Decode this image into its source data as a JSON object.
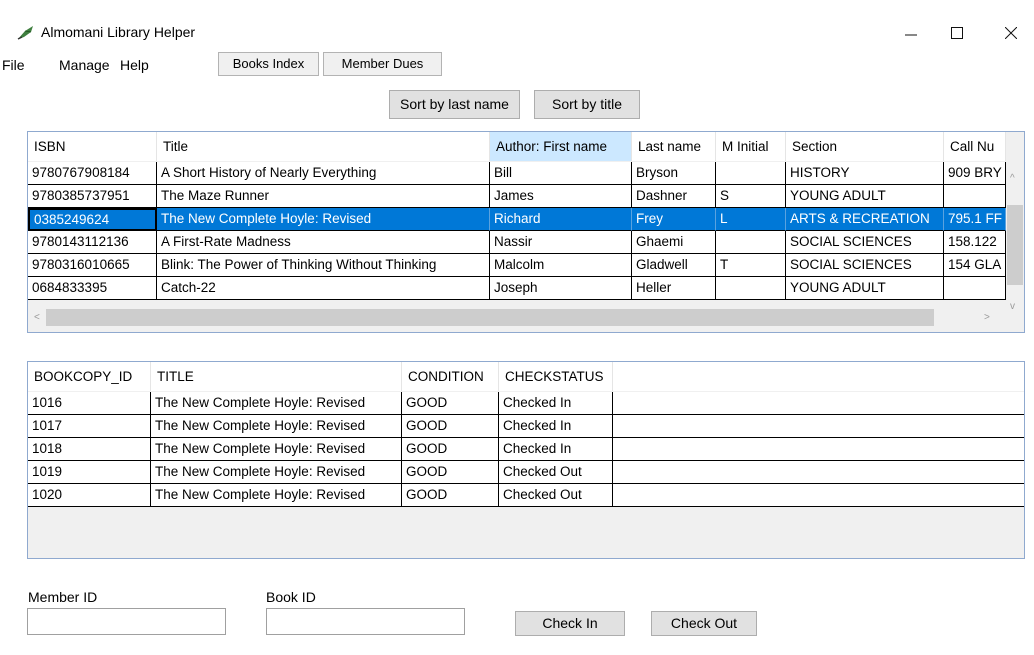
{
  "window": {
    "title": "Almomani Library Helper",
    "controls": {
      "minimize": "—",
      "maximize": "☐",
      "close": "✕"
    }
  },
  "menu": [
    "File",
    "Manage",
    "Help"
  ],
  "tabs": [
    {
      "label": "Books Index",
      "active": true
    },
    {
      "label": "Member Dues",
      "active": false
    }
  ],
  "sort_buttons": {
    "by_last_name": "Sort by last name",
    "by_title": "Sort by title"
  },
  "books_grid": {
    "columns": [
      "ISBN",
      "Title",
      "Author: First name",
      "Last name",
      "M Initial",
      "Section",
      "Call Nu"
    ],
    "rows": [
      [
        "9780767908184",
        "A Short History of Nearly Everything",
        "Bill",
        "Bryson",
        "",
        "HISTORY",
        "909 BRY"
      ],
      [
        "9780385737951",
        "The Maze Runner",
        "James",
        "Dashner",
        "S",
        "YOUNG ADULT",
        ""
      ],
      [
        "0385249624",
        "The New Complete Hoyle: Revised",
        "Richard",
        "Frey",
        "L",
        "ARTS & RECREATION",
        "795.1 FF"
      ],
      [
        "9780143112136",
        "A First-Rate Madness",
        "Nassir",
        "Ghaemi",
        "",
        "SOCIAL SCIENCES",
        "158.122"
      ],
      [
        "9780316010665",
        "Blink: The Power of Thinking Without Thinking",
        "Malcolm",
        "Gladwell",
        "T",
        "SOCIAL SCIENCES",
        "154 GLA"
      ],
      [
        "0684833395",
        "Catch-22",
        "Joseph",
        "Heller",
        "",
        "YOUNG ADULT",
        ""
      ]
    ],
    "selected_row": 2,
    "active_header": 2
  },
  "copies_grid": {
    "columns": [
      "BOOKCOPY_ID",
      "TITLE",
      "CONDITION",
      "CHECKSTATUS"
    ],
    "rows": [
      [
        "1016",
        "The New Complete Hoyle: Revised",
        "GOOD",
        "Checked In"
      ],
      [
        "1017",
        "The New Complete Hoyle: Revised",
        "GOOD",
        "Checked In"
      ],
      [
        "1018",
        "The New Complete Hoyle: Revised",
        "GOOD",
        "Checked In"
      ],
      [
        "1019",
        "The New Complete Hoyle: Revised",
        "GOOD",
        "Checked Out"
      ],
      [
        "1020",
        "The New Complete Hoyle: Revised",
        "GOOD",
        "Checked Out"
      ]
    ]
  },
  "form": {
    "member_id_label": "Member ID",
    "member_id_value": "",
    "book_id_label": "Book ID",
    "book_id_value": "",
    "check_in": "Check In",
    "check_out": "Check Out"
  },
  "colors": {
    "selection": "#0078d7",
    "header_hover": "#cce8ff",
    "grid_border": "#8fa9cf"
  }
}
